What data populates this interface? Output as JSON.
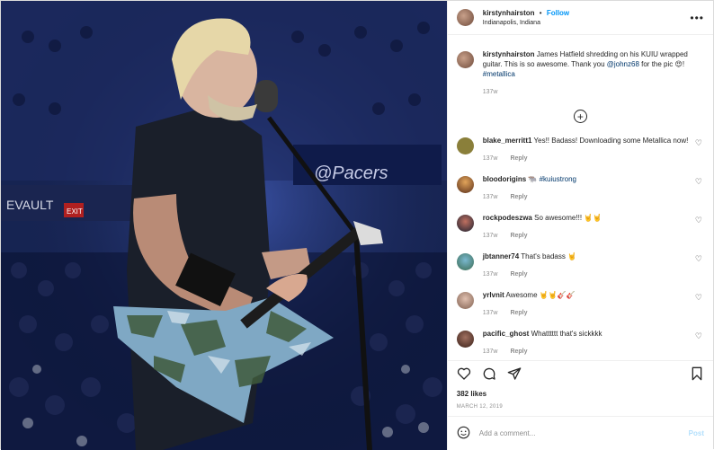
{
  "author": {
    "username": "kirstynhairston",
    "separator": "•",
    "follow_label": "Follow",
    "location": "Indianapolis, Indiana",
    "more_label": "•••"
  },
  "caption": {
    "username": "kirstynhairston",
    "text": "James Hatfield shredding on his KUIU wrapped guitar. This is so awesome. Thank you ",
    "mention": "@johnz68",
    "text2": " for the pic 😍!",
    "hashtag": "#metallica",
    "time": "137w"
  },
  "load_more_label": "+",
  "comments": [
    {
      "username": "blake_merritt1",
      "text": "Yes!! Badass! Downloading some Metallica now!",
      "tag": "",
      "time": "137w",
      "reply": "Reply",
      "avatar_color": "#8a7f3a"
    },
    {
      "username": "bloodorigins",
      "text": "🐃 ",
      "tag": "#kuiustrong",
      "time": "137w",
      "reply": "Reply",
      "avatar_color": "#b5652a"
    },
    {
      "username": "rockpodeszwa",
      "text": "So awesome!!! 🤘🤘",
      "tag": "",
      "time": "137w",
      "reply": "Reply",
      "avatar_color": "#3a4a6a"
    },
    {
      "username": "jbtanner74",
      "text": "That's badass 🤘",
      "tag": "",
      "time": "137w",
      "reply": "Reply",
      "avatar_color": "#5a9ab5"
    },
    {
      "username": "yrlvnit",
      "text": "Awesome 🤘🤘🎸🎸",
      "tag": "",
      "time": "137w",
      "reply": "Reply",
      "avatar_color": "#c0a090"
    },
    {
      "username": "pacific_ghost",
      "text": "Whatttttt that's sickkkk",
      "tag": "",
      "time": "137w",
      "reply": "Reply",
      "avatar_color": "#6a4a3a"
    }
  ],
  "icons": {
    "like": "heart-icon",
    "comment": "comment-icon",
    "share": "share-icon",
    "save": "bookmark-icon",
    "emoji": "emoji-icon"
  },
  "likes_label": "382 likes",
  "date_label": "MARCH 12, 2019",
  "add_comment": {
    "placeholder": "Add a comment...",
    "post_label": "Post"
  },
  "colors": {
    "accent": "#0095f6",
    "post_disabled": "#b2dffc"
  },
  "photo_signs": {
    "exit": "EXIT",
    "vault": "EVAULT",
    "pacers": "@Pacers"
  }
}
